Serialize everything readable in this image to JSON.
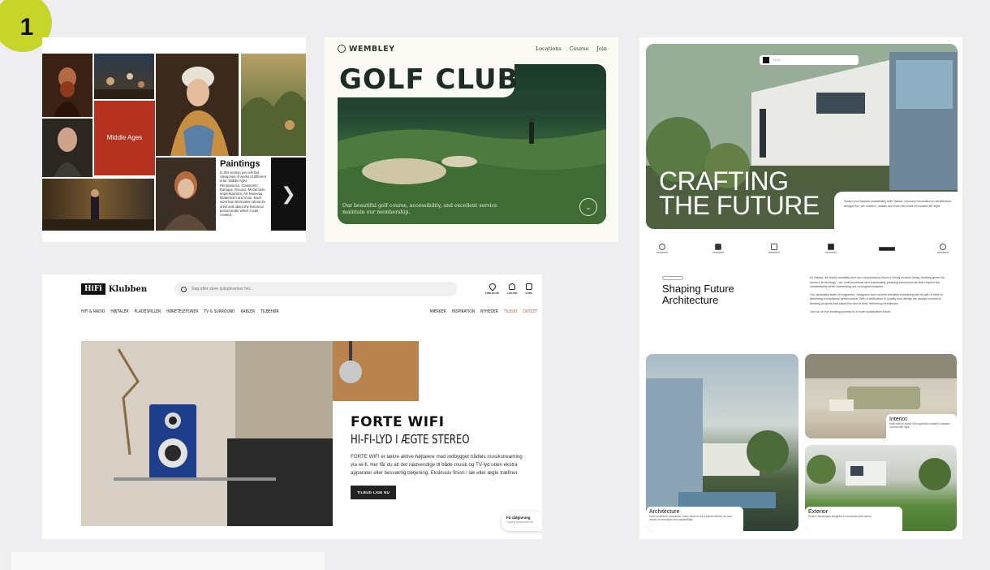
{
  "badge": {
    "number": "1"
  },
  "paintings": {
    "middle_ages": "Middle Ages",
    "title": "Paintings",
    "body": "In this section you will find categories of works of different eras: Middle Ages, Renaissance, Classicism, Baroque, Rococo, Modernism, Impressionism, Art Nouveau, Modernism and more. Each work has information about its artist and about the historical period under which it was created.",
    "next_icon": "chevron-right-icon"
  },
  "golf": {
    "brand": "WEMBLEY",
    "nav": [
      "Locations",
      "Course",
      "Join"
    ],
    "title": "GOLF CLUB",
    "caption": "Our beautiful golf course, accessibility, and excellent service maintain our membership.",
    "scroll_icon": "chevron-down-icon",
    "colors": {
      "accent": "#1d2c25"
    }
  },
  "arch": {
    "headline_1": "CRAFTING",
    "headline_2": "THE FUTURE",
    "intro": "Sculpt your spaces sustainably with Takara. Discover innovation in architecture, designs for rich modern, classic and even the most innovative life style.",
    "section_title_1": "Shaping Future",
    "section_title_2": "Architecture",
    "body": [
      "At Takara, we blend creativity and our conscientious focus to bring modern living, building green for modern technology - we craft functional and sustainably pleasing environments that respect the sustainability while harnessing our ecological footprint.",
      "Our dedicated team of engineers, designers and experts elevates everything we do with a helix to delivering exceptional performance. With a dedication to quality and design we always commit to building projects that stand the test of time, delivering excellence.",
      "Join us on the exciting journey to a more sustainable future."
    ],
    "cards": [
      {
        "title": "Architecture",
        "text": "From concept to completion, every detail of our projects reflects our core values of innovation and sustainability."
      },
      {
        "title": "Interior",
        "text": "Each interior space is thoughtfully curated to balance comfort with style."
      },
      {
        "title": "Exterior",
        "text": "Exterior landscapes designed to harmonize with nature."
      }
    ]
  },
  "hifi": {
    "logo_box": "HiFi",
    "logo_name": "Klubben",
    "search_placeholder": "Søg efter store lydoplevelser her...",
    "actions": [
      "FIND BUTIK",
      "LOG IND",
      "KURV"
    ],
    "nav_left": [
      "HIFI & RADIO",
      "HØJTALER",
      "PLADESPILLER",
      "HØRETELEFONER",
      "TV & SURROUND",
      "KABLER",
      "TILBEHØR"
    ],
    "nav_right": [
      "MÆRKER",
      "INSPIRATION",
      "NYHEDER"
    ],
    "nav_red": [
      "TILBUD",
      "OUTLET"
    ],
    "hero_title": "FORTE WIFI",
    "hero_subtitle": "HI-FI-LYD I ÆGTE STEREO",
    "hero_text": "FORTE WIFI er lækre aktive højtalere med indbygget trådløs musikstreaming via wi-fi. Her får du alt det nødvendige til både musik og TV-lyd uden ekstra apparater eller besværlig betjening. Eksklusiv finish i lak eller ægte træfiner.",
    "cta": "TILBUD LIGE NU",
    "chat_title": "Få rådgivning",
    "chat_sub": "Spørg eksperterne",
    "colors": {
      "sale": "#e5533f"
    }
  }
}
